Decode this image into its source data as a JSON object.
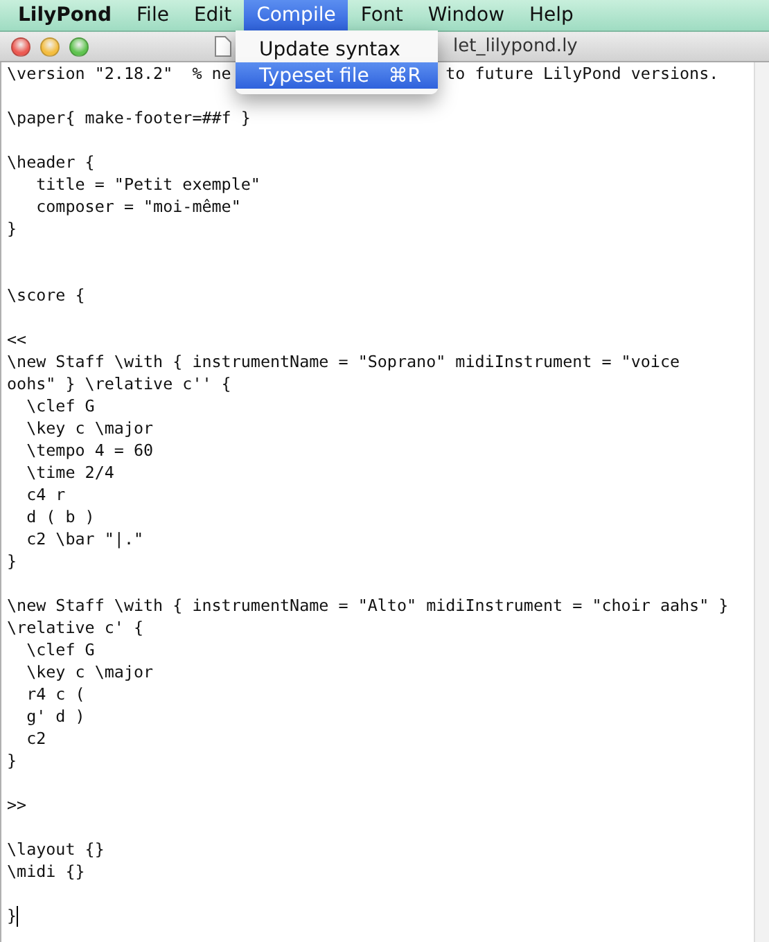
{
  "menubar": {
    "items": [
      {
        "label": "LilyPond",
        "selected": false,
        "app": true
      },
      {
        "label": "File",
        "selected": false,
        "app": false
      },
      {
        "label": "Edit",
        "selected": false,
        "app": false
      },
      {
        "label": "Compile",
        "selected": true,
        "app": false
      },
      {
        "label": "Font",
        "selected": false,
        "app": false
      },
      {
        "label": "Window",
        "selected": false,
        "app": false
      },
      {
        "label": "Help",
        "selected": false,
        "app": false
      }
    ]
  },
  "menu": {
    "items": [
      {
        "label": "Update syntax",
        "selected": false
      },
      {
        "label": "Typeset file",
        "shortcut": "⌘R",
        "selected": true
      }
    ]
  },
  "window": {
    "title": "let_lilypond.ly"
  },
  "editor": {
    "first_line": [
      "\\version \"2.18.2\"  % ne",
      "to future LilyPond versions."
    ],
    "lines": [
      {
        "kind": "blank"
      },
      {
        "kind": "code",
        "text": "\\paper{ make-footer=##f }"
      },
      {
        "kind": "blank"
      },
      {
        "kind": "code",
        "text": "\\header {"
      },
      {
        "kind": "code",
        "text": "   title = \"Petit exemple\""
      },
      {
        "kind": "code",
        "text": "   composer = \"moi-même\""
      },
      {
        "kind": "code",
        "text": "}"
      },
      {
        "kind": "blank"
      },
      {
        "kind": "blank"
      },
      {
        "kind": "code",
        "text": "\\score {"
      },
      {
        "kind": "blank"
      },
      {
        "kind": "code",
        "text": "<<"
      },
      {
        "kind": "code",
        "text": "\\new Staff \\with { instrumentName = \"Soprano\" midiInstrument = \"voice"
      },
      {
        "kind": "code",
        "text": "oohs\" } \\relative c'' {"
      },
      {
        "kind": "code",
        "text": "  \\clef G"
      },
      {
        "kind": "code",
        "text": "  \\key c \\major"
      },
      {
        "kind": "code",
        "text": "  \\tempo 4 = 60"
      },
      {
        "kind": "code",
        "text": "  \\time 2/4"
      },
      {
        "kind": "code",
        "text": "  c4 r"
      },
      {
        "kind": "code",
        "text": "  d ( b )"
      },
      {
        "kind": "code",
        "text": "  c2 \\bar \"|.\""
      },
      {
        "kind": "code",
        "text": "}"
      },
      {
        "kind": "blank"
      },
      {
        "kind": "code",
        "text": "\\new Staff \\with { instrumentName = \"Alto\" midiInstrument = \"choir aahs\" }"
      },
      {
        "kind": "code",
        "text": "\\relative c' {"
      },
      {
        "kind": "code",
        "text": "  \\clef G"
      },
      {
        "kind": "code",
        "text": "  \\key c \\major"
      },
      {
        "kind": "code",
        "text": "  r4 c ("
      },
      {
        "kind": "code",
        "text": "  g' d )"
      },
      {
        "kind": "code",
        "text": "  c2"
      },
      {
        "kind": "code",
        "text": "}"
      },
      {
        "kind": "blank"
      },
      {
        "kind": "code",
        "text": ">>"
      },
      {
        "kind": "blank"
      },
      {
        "kind": "code",
        "text": "\\layout {}"
      },
      {
        "kind": "code",
        "text": "\\midi {}"
      },
      {
        "kind": "blank"
      },
      {
        "kind": "code",
        "text": "}"
      }
    ]
  }
}
